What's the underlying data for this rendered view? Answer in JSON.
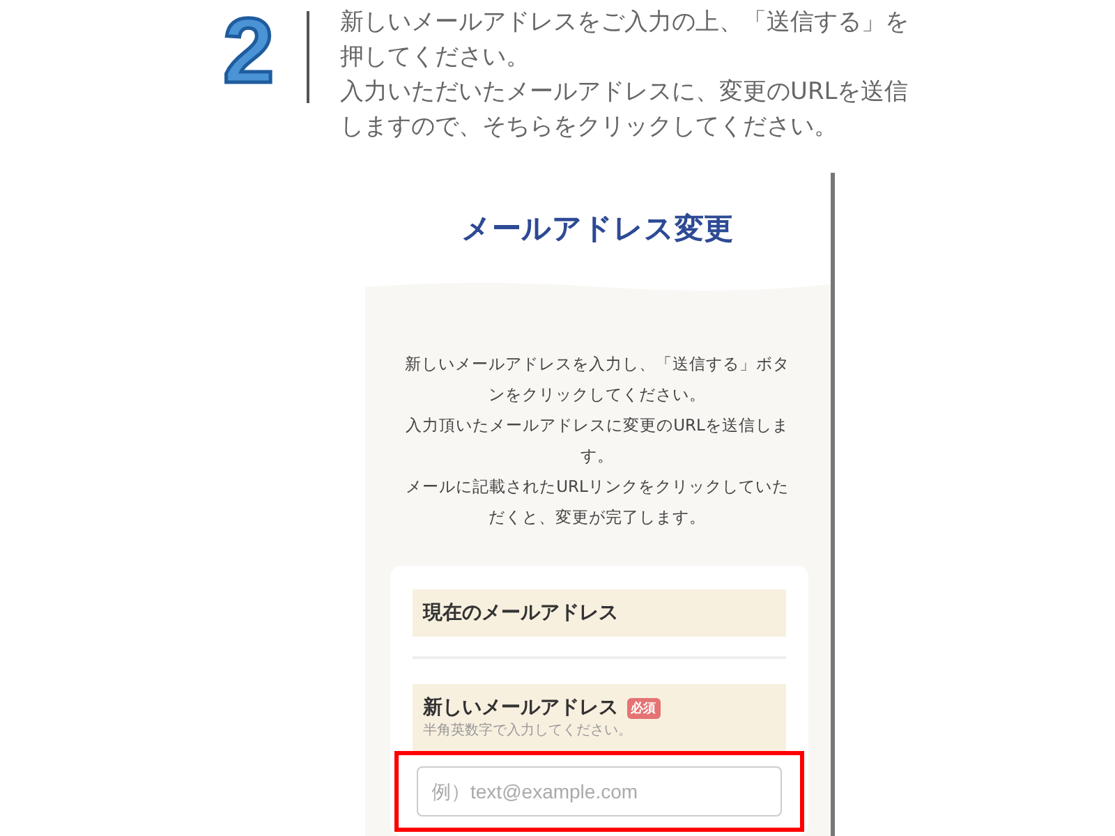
{
  "step": {
    "number": "2",
    "lines": [
      "新しいメールアドレスをご入力の上、「送信する」を",
      "押してください。",
      "入力いただいたメールアドレスに、変更のURLを送信",
      "しますので、そちらをクリックしてください。"
    ]
  },
  "screen": {
    "title": "メールアドレス変更",
    "description": [
      "新しいメールアドレスを入力し、「送信する」ボタ",
      "ンをクリックしてください。",
      "入力頂いたメールアドレスに変更のURLを送信しま",
      "す。",
      "メールに記載されたURLリンクをクリックしていた",
      "だくと、変更が完了します。"
    ],
    "fields": [
      {
        "label": "現在のメールアドレス"
      },
      {
        "label": "新しいメールアドレス",
        "badge": "必須",
        "hint": "半角英数字で入力してください。",
        "placeholder": "例）text@example.com",
        "highlighted": true
      }
    ]
  }
}
